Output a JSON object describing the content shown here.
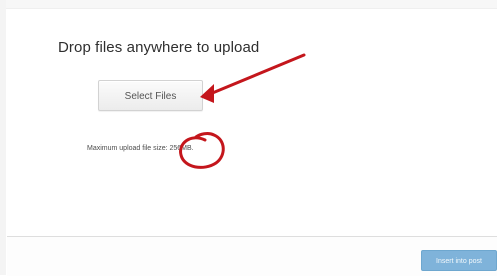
{
  "upload": {
    "title": "Drop files anywhere to upload",
    "select_label": "Select Files",
    "max_size_label": "Maximum upload file size:",
    "max_size_value": "256MB."
  },
  "footer": {
    "insert_label": "Insert into post"
  },
  "annotation": {
    "color": "#c4161c",
    "arrow_target": "select-button",
    "circle_target": "max-size-value"
  }
}
